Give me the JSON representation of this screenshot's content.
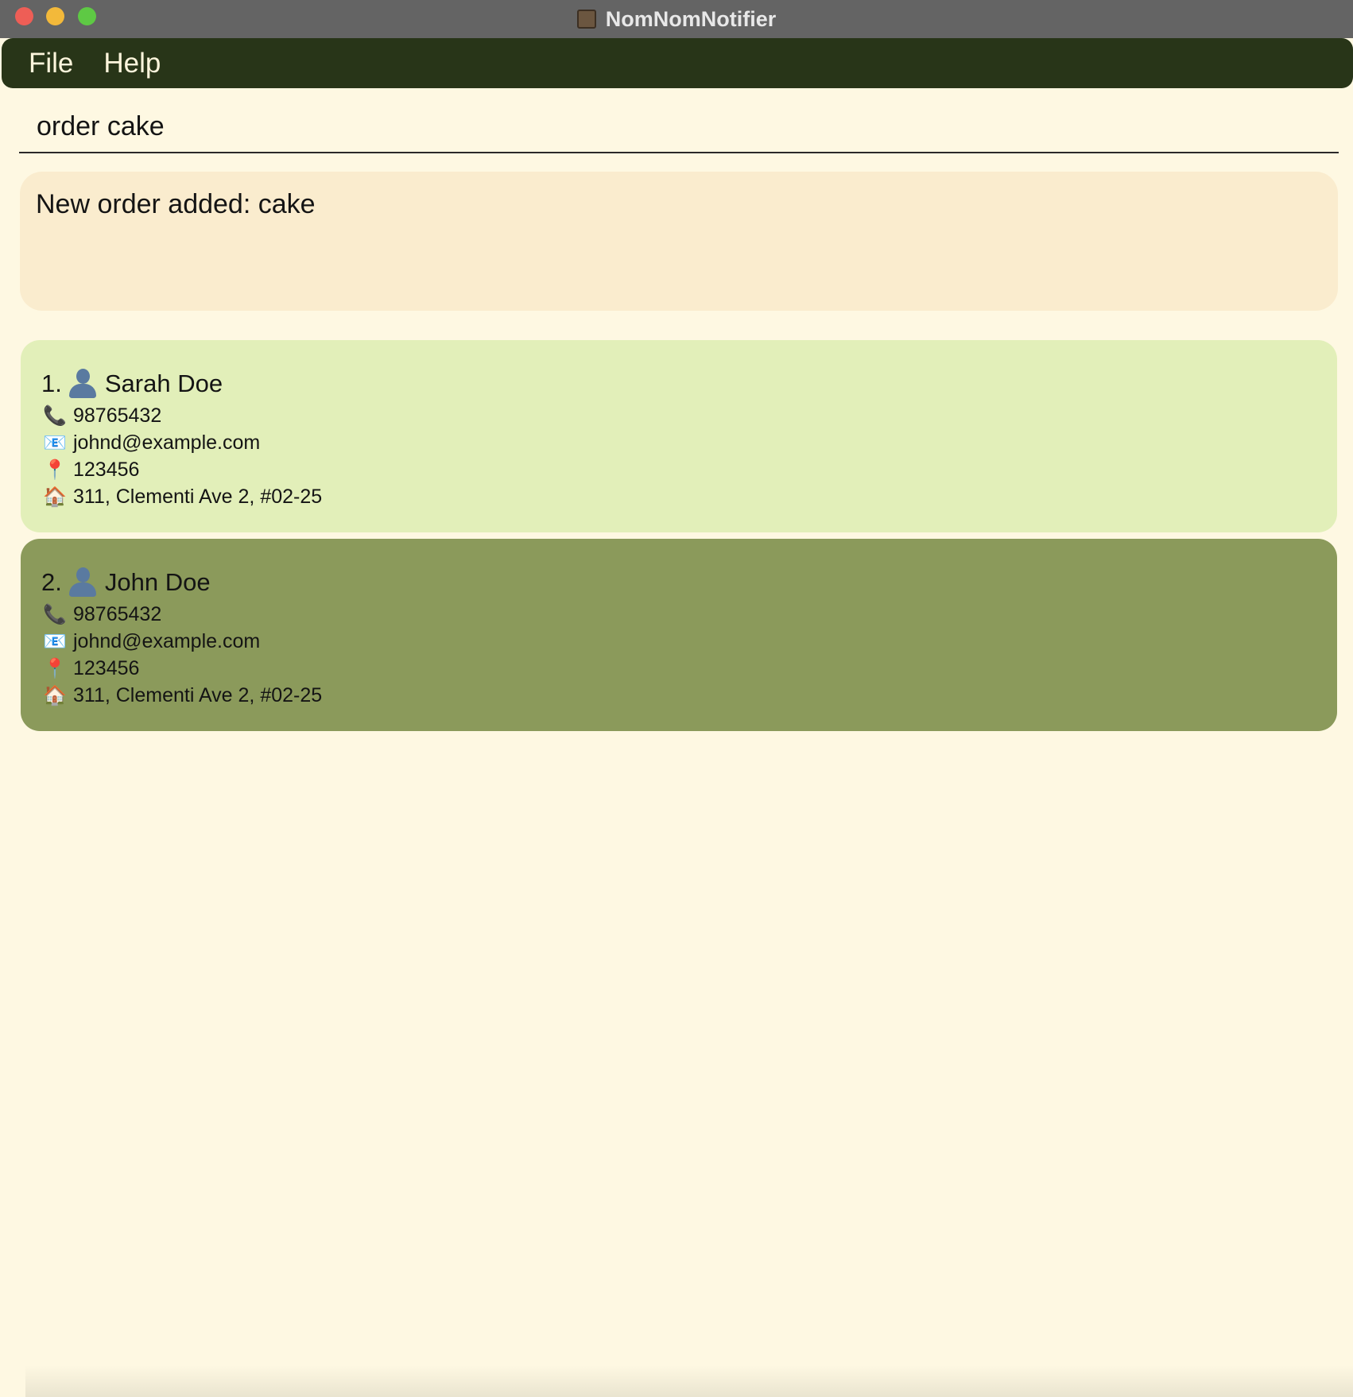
{
  "window": {
    "title": "NomNomNotifier"
  },
  "menu": {
    "items": [
      "File",
      "Help"
    ]
  },
  "command": {
    "value": "order cake"
  },
  "result": {
    "message": "New order added: cake"
  },
  "contacts": [
    {
      "index": "1.",
      "name": "Sarah Doe",
      "phone": "98765432",
      "email": "johnd@example.com",
      "postal": "123456",
      "address": "311, Clementi Ave 2, #02-25"
    },
    {
      "index": "2.",
      "name": "John Doe",
      "phone": "98765432",
      "email": "johnd@example.com",
      "postal": "123456",
      "address": "311, Clementi Ave 2, #02-25"
    }
  ],
  "icons": {
    "name": "person-icon",
    "phone": "phone-icon",
    "email": "email-icon",
    "postal": "pin-icon",
    "address": "house-icon"
  },
  "colors": {
    "menubar": "#283518",
    "card_default": "#e2efb9",
    "card_selected": "#8b9a5b",
    "result": "#faecce",
    "background": "#fef8e2"
  }
}
